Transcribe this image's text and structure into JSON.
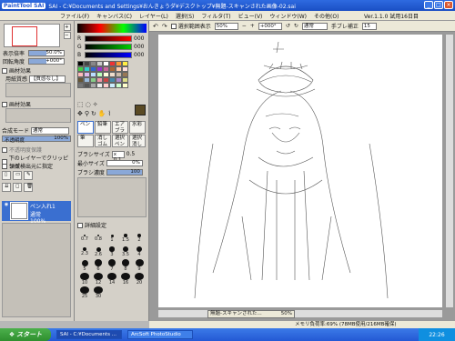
{
  "titlebar": {
    "logo": "PaintTool SAI",
    "title": "SAI - C:¥Documents and Settings¥おんきょうダ¥デスクトップ¥無題-スキャンされた画像-02.sai"
  },
  "menubar": {
    "items": [
      "ファイル(F)",
      "キャンバス(C)",
      "レイヤー(L)",
      "選択(S)",
      "フィルタ(T)",
      "ビュー(V)",
      "ウィンドウ(W)",
      "その他(O)"
    ],
    "version": "Ver.1.1.0 試用16日目"
  },
  "toolbar": {
    "select_show": "選択範囲表示",
    "zoom": "50%",
    "angle": "+000°",
    "blend": "通常",
    "stabilizer_label": "手ブレ補正",
    "stabilizer_value": "15"
  },
  "leftpanel": {
    "mag_label": "表示倍率",
    "mag_value": "50.0%",
    "rot_label": "回転角度",
    "rot_value": "+000°",
    "paper_label": "画材効果",
    "paper_tex": "用紙質感",
    "paper_tex_value": "【質感なし】",
    "effect_label": "画材効果",
    "blend_label": "合成モード",
    "blend_value": "通常",
    "opacity_label": "不透明度",
    "opacity_value": "100%",
    "protect_label": "不透明度保護",
    "clip_label": "下のレイヤーでクリッピング",
    "source_label": "領域検出元に指定",
    "layers": [
      {
        "name": "ペン入れ1",
        "mode": "通常",
        "opacity": "100%"
      }
    ]
  },
  "colorpanel": {
    "r": "000",
    "g": "000",
    "b": "000",
    "tools": [
      "ペン",
      "鉛筆",
      "エアブラシ",
      "水彩",
      "筆",
      "消しゴム",
      "選択ペン",
      "選択消し",
      "バケツ"
    ],
    "brush_size_label": "ブラシサイズ",
    "brush_size_x": "x 0.1",
    "brush_size_value": "0.5",
    "min_size_label": "最小サイズ",
    "min_size_value": "0%",
    "density_label": "ブラシ濃度",
    "density_value": "100",
    "detail_label": "詳細設定",
    "sizes": [
      "0.7",
      "0.8",
      "1",
      "1.5",
      "2",
      "2.3",
      "2.6",
      "3",
      "3.5",
      "4",
      "5",
      "6",
      "7",
      "8",
      "9",
      "10",
      "12",
      "14",
      "16",
      "20",
      "25",
      "30"
    ]
  },
  "statusbar": {
    "doc_tab": "無題-スキャンされた...",
    "doc_zoom": "50%",
    "memory": "メモリ負荷率:69% (78MB使用/216MB確保)"
  },
  "taskbar": {
    "start": "スタート",
    "tasks": [
      "SAI - C:¥Documents ...",
      "ArcSoft PhotoStudio"
    ],
    "clock": "22:26"
  }
}
